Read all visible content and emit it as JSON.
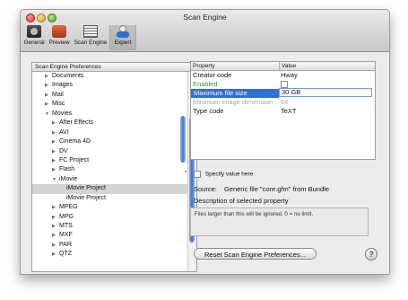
{
  "window": {
    "title": "Scan Engine"
  },
  "toolbar": {
    "items": [
      {
        "label": "General",
        "icon": "general-icon"
      },
      {
        "label": "Preview",
        "icon": "preview-icon"
      },
      {
        "label": "Scan Engine",
        "icon": "scan-engine-icon"
      },
      {
        "label": "Expert",
        "icon": "expert-icon"
      }
    ],
    "selected": "Expert"
  },
  "tree": {
    "header": "Scan Engine Preferences",
    "items": [
      {
        "label": "Documents",
        "expanded": false
      },
      {
        "label": "Images",
        "expanded": false
      },
      {
        "label": "Mail",
        "expanded": false
      },
      {
        "label": "Misc",
        "expanded": false
      },
      {
        "label": "Movies",
        "expanded": true
      },
      {
        "label": "After Effects",
        "expanded": false
      },
      {
        "label": "AVI",
        "expanded": false
      },
      {
        "label": "Cinema 4D",
        "expanded": false
      },
      {
        "label": "DV",
        "expanded": false
      },
      {
        "label": "FC Project",
        "expanded": false
      },
      {
        "label": "Flash",
        "expanded": false
      },
      {
        "label": "iMovie",
        "expanded": true
      },
      {
        "label": "iMovie Project",
        "selected": true
      },
      {
        "label": "iMovie Project"
      },
      {
        "label": "MPEG",
        "expanded": false
      },
      {
        "label": "MPG",
        "expanded": false
      },
      {
        "label": "MTS",
        "expanded": false
      },
      {
        "label": "MXF",
        "expanded": false
      },
      {
        "label": "PAR",
        "expanded": false
      },
      {
        "label": "QTZ",
        "expanded": false
      }
    ]
  },
  "properties": {
    "col_property": "Property",
    "col_value": "Value",
    "rows": [
      {
        "name": "Creator code",
        "value": "Hway"
      },
      {
        "name": "Enabled",
        "value": "",
        "type": "checkbox"
      },
      {
        "name": "Maximum file size",
        "value": "30 GB"
      },
      {
        "name": "Minimum image dimension",
        "value": "64"
      },
      {
        "name": "Type code",
        "value": "TeXT"
      }
    ]
  },
  "specify_value_label": "Specify value here",
  "source": {
    "label": "Source:",
    "value": "Generic file \"core.gfm\" from Bundle"
  },
  "description": {
    "title": "Description of selected property",
    "text": "Files larger than this will be ignored. 0 = no limit."
  },
  "reset_button_label": "Reset Scan Engine Preferences...",
  "help_label": "?"
}
